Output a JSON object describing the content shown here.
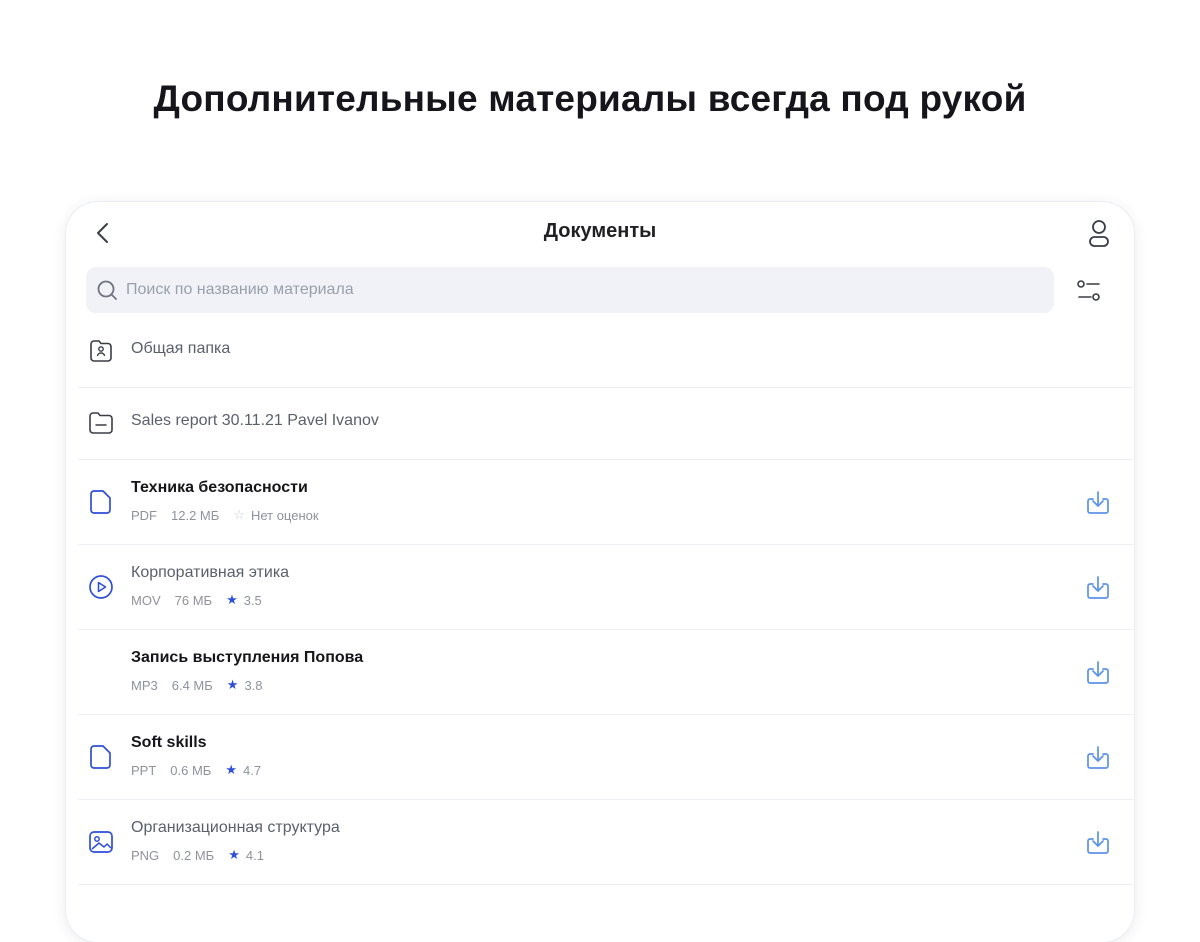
{
  "headline": "Дополнительные материалы всегда под рукой",
  "screen": {
    "title": "Документы",
    "search": {
      "placeholder": "Поиск по названию материала",
      "value": ""
    }
  },
  "colors": {
    "accent": "#2f4fd8",
    "download": "#5b93e6",
    "search_bg": "#f0f2f7"
  },
  "items": [
    {
      "kind": "folder",
      "icon": "shared-folder-icon",
      "title": "Общая папка"
    },
    {
      "kind": "folder",
      "icon": "folder-icon",
      "title": "Sales report 30.11.21 Pavel Ivanov"
    },
    {
      "kind": "file",
      "icon": "document-icon",
      "title": "Техника безопасности",
      "format": "PDF",
      "size": "12.2 МБ",
      "rating": "Нет оценок",
      "rated": false
    },
    {
      "kind": "file",
      "icon": "video-icon",
      "title": "Корпоративная этика",
      "format": "MOV",
      "size": "76 МБ",
      "rating": "3.5",
      "rated": true
    },
    {
      "kind": "file",
      "icon": "",
      "title": "Запись выступления Попова",
      "format": "MP3",
      "size": "6.4 МБ",
      "rating": "3.8",
      "rated": true
    },
    {
      "kind": "file",
      "icon": "document-icon",
      "title": "Soft skills",
      "format": "PPT",
      "size": "0.6 МБ",
      "rating": "4.7",
      "rated": true
    },
    {
      "kind": "file",
      "icon": "image-icon",
      "title": "Организационная структура",
      "format": "PNG",
      "size": "0.2 МБ",
      "rating": "4.1",
      "rated": true
    }
  ]
}
